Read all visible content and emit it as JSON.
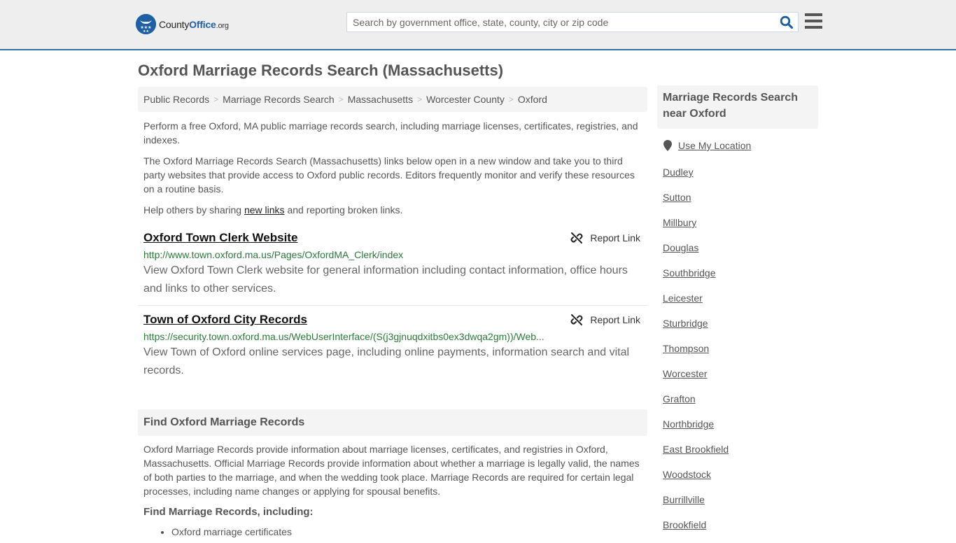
{
  "header": {
    "logo_name": "County",
    "logo_office": "Office",
    "logo_tld": ".org",
    "search_placeholder": "Search by government office, state, county, city or zip code",
    "search_value": "",
    "brand_color": "#1f5fa3",
    "accent_line_color": "#2f73ad"
  },
  "page": {
    "title": "Oxford Marriage Records Search (Massachusetts)"
  },
  "breadcrumb": [
    "Public Records",
    "Marriage Records Search",
    "Massachusetts",
    "Worcester County",
    "Oxford"
  ],
  "intro": {
    "p1": "Perform a free Oxford, MA public marriage records search, including marriage licenses, certificates, registries, and indexes.",
    "p2": "The Oxford Marriage Records Search (Massachusetts) links below open in a new window and take you to third party websites that provide access to Oxford public records. Editors frequently monitor and verify these resources on a routine basis.",
    "p3_before": "Help others by sharing ",
    "p3_link": "new links",
    "p3_after": " and reporting broken links."
  },
  "results": [
    {
      "title": "Oxford Town Clerk Website",
      "url": "http://www.town.oxford.ma.us/Pages/OxfordMA_Clerk/index",
      "description": "View Oxford Town Clerk website for general information including contact information, office hours and links to other services.",
      "report_label": "Report Link"
    },
    {
      "title": "Town of Oxford City Records",
      "url": "https://security.town.oxford.ma.us/WebUserInterface/(S(j3gjnuqdxitbs0ex3dwqa2gm))/Web...",
      "description": "View Town of Oxford online services page, including online payments, information search and vital records.",
      "report_label": "Report Link"
    }
  ],
  "find_section": {
    "heading": "Find Oxford Marriage Records",
    "body": "Oxford Marriage Records provide information about marriage licenses, certificates, and registries in Oxford, Massachusetts. Official Marriage Records provide information about whether a marriage is legally valid, the names of both parties to the marriage, and when the wedding took place. Marriage Records are required for certain legal processes, including name changes or applying for spousal benefits.",
    "subheading": "Find Marriage Records, including:",
    "bullets": [
      "Oxford marriage certificates"
    ]
  },
  "sidebar": {
    "heading": "Marriage Records Search near Oxford",
    "use_location": "Use My Location",
    "places": [
      "Dudley",
      "Sutton",
      "Millbury",
      "Douglas",
      "Southbridge",
      "Leicester",
      "Sturbridge",
      "Thompson",
      "Worcester",
      "Grafton",
      "Northbridge",
      "East Brookfield",
      "Woodstock",
      "Burrillville",
      "Brookfield"
    ]
  }
}
